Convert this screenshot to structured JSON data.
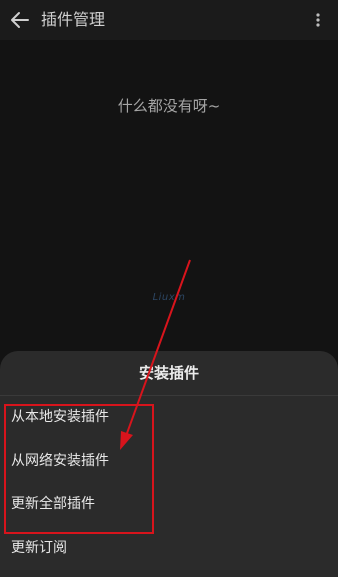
{
  "app_bar": {
    "title": "插件管理",
    "back_icon": "arrow-left-icon",
    "more_icon": "more-vertical-icon"
  },
  "main": {
    "empty_message": "什么都没有呀~"
  },
  "watermark": {
    "text": "Liuxm"
  },
  "install_sheet": {
    "title": "安装插件",
    "items": [
      {
        "label": "从本地安装插件"
      },
      {
        "label": "从网络安装插件"
      },
      {
        "label": "更新全部插件"
      },
      {
        "label": "更新订阅"
      }
    ]
  },
  "annotation": {
    "color": "#d8141c"
  }
}
